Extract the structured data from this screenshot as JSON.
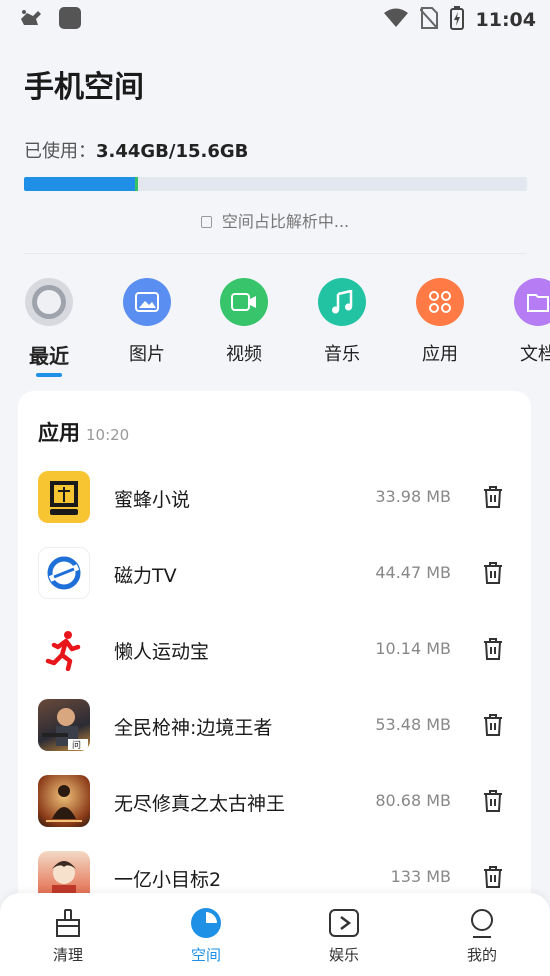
{
  "status_bar": {
    "time": "11:04",
    "icons": [
      "drone-icon",
      "app-square-icon",
      "wifi-icon",
      "no-sim-icon",
      "battery-charging-icon"
    ]
  },
  "header": {
    "title": "手机空间",
    "usage_label": "已使用：",
    "usage_used": "3.44GB",
    "usage_total": "/15.6GB",
    "usage_fraction": 0.22,
    "analyzing_text": "空间占比解析中..."
  },
  "categories": [
    {
      "label": "最近",
      "icon": "recent-icon",
      "color": "#d7d9de",
      "active": true
    },
    {
      "label": "图片",
      "icon": "image-icon",
      "color": "#5a8ef0"
    },
    {
      "label": "视频",
      "icon": "video-icon",
      "color": "#37c46b"
    },
    {
      "label": "音乐",
      "icon": "music-icon",
      "color": "#22c3a2"
    },
    {
      "label": "应用",
      "icon": "apps-icon",
      "color": "#ff7a45"
    },
    {
      "label": "文档",
      "icon": "document-icon",
      "color": "#b57cf4"
    }
  ],
  "recent": {
    "title": "应用",
    "time": "10:20",
    "apps": [
      {
        "name": "蜜蜂小说",
        "size": "33.98 MB",
        "icon": "bee-novel-icon"
      },
      {
        "name": "磁力TV",
        "size": "44.47 MB",
        "icon": "magnet-tv-icon"
      },
      {
        "name": "懒人运动宝",
        "size": "10.14 MB",
        "icon": "runner-icon"
      },
      {
        "name": "全民枪神:边境王者",
        "size": "53.48 MB",
        "icon": "gun-game-icon"
      },
      {
        "name": "无尽修真之太古神王",
        "size": "80.68 MB",
        "icon": "xiuzhen-game-icon"
      },
      {
        "name": "一亿小目标2",
        "size": "133 MB",
        "icon": "target-game-icon"
      }
    ]
  },
  "bottom_nav": [
    {
      "label": "清理",
      "icon": "clean-icon"
    },
    {
      "label": "空间",
      "icon": "space-pie-icon",
      "active": true
    },
    {
      "label": "娱乐",
      "icon": "play-icon"
    },
    {
      "label": "我的",
      "icon": "profile-icon"
    }
  ],
  "colors": {
    "accent": "#1e90e6",
    "bar_track": "#e3e7ef",
    "background": "#f4f5f9"
  }
}
